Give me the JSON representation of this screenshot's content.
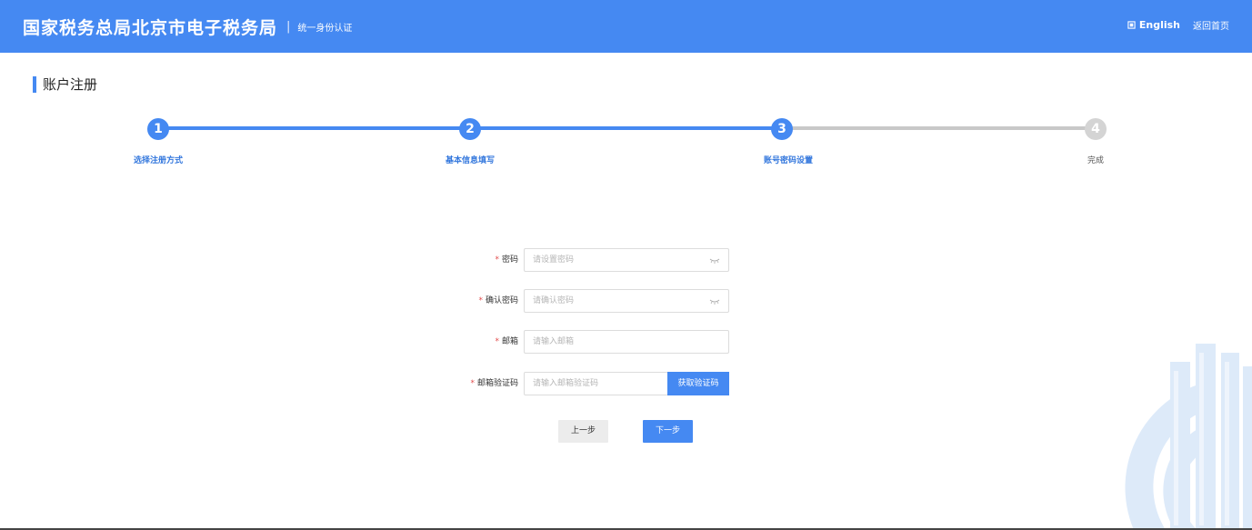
{
  "header": {
    "title": "国家税务总局北京市电子税务局",
    "separator": "|",
    "subtitle": "统一身份认证",
    "lang_label": "English",
    "home_label": "返回首页"
  },
  "page": {
    "title": "账户注册"
  },
  "steps": [
    {
      "number": "1",
      "label": "选择注册方式",
      "done": true
    },
    {
      "number": "2",
      "label": "基本信息填写",
      "done": true
    },
    {
      "number": "3",
      "label": "账号密码设置",
      "done": true
    },
    {
      "number": "4",
      "label": "完成",
      "done": false
    }
  ],
  "form": {
    "required_mark": "*",
    "password": {
      "label": "密码",
      "value": "",
      "placeholder": "请设置密码"
    },
    "confirm_password": {
      "label": "确认密码",
      "value": "",
      "placeholder": "请确认密码"
    },
    "email": {
      "label": "邮箱",
      "value": "",
      "placeholder": "请输入邮箱"
    },
    "email_code": {
      "label": "邮箱验证码",
      "value": "",
      "placeholder": "请输入邮箱验证码",
      "button_label": "获取验证码"
    }
  },
  "actions": {
    "prev_label": "上一步",
    "next_label": "下一步"
  },
  "colors": {
    "accent": "#4589f2",
    "inactive": "#c8c8c8",
    "required": "#e24c4c"
  },
  "icons": [
    "globe-icon",
    "eye-closed-icon",
    "tax-logo-watermark"
  ]
}
